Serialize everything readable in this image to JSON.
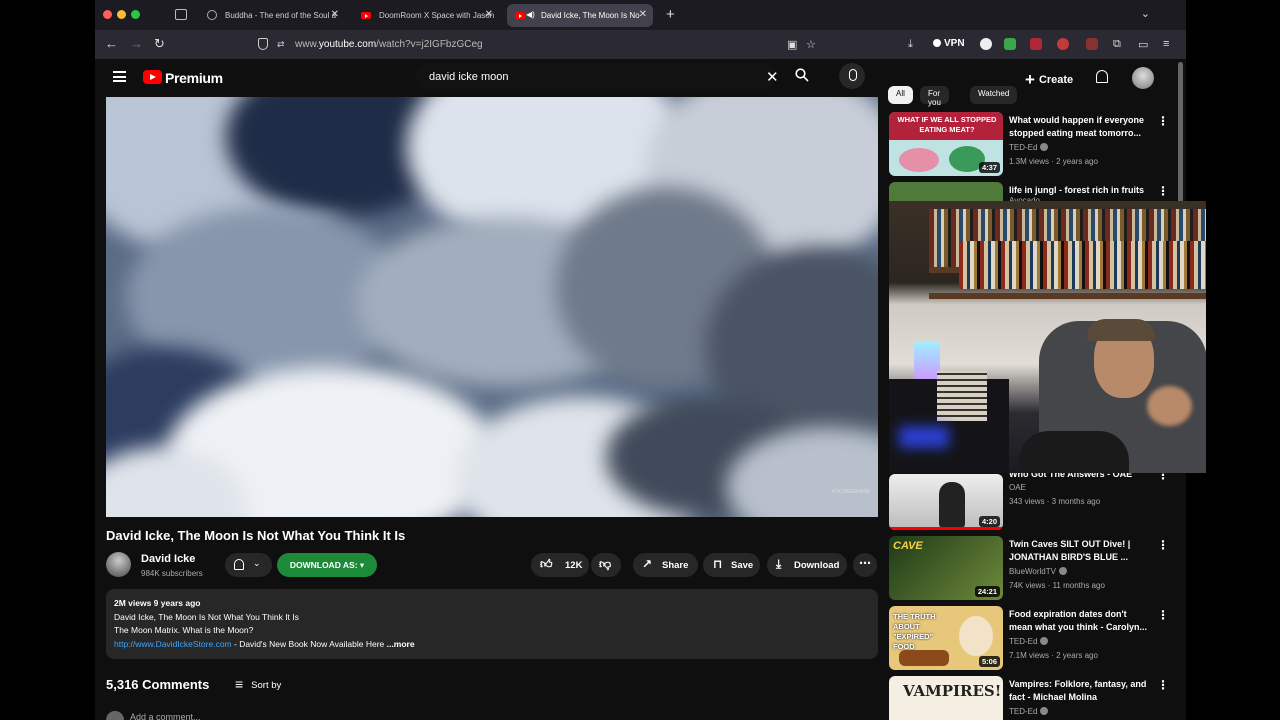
{
  "browser": {
    "tabs": [
      {
        "title": "Buddha - The end of the Soul a",
        "active": false
      },
      {
        "title": "DoomRoom X Space with Jason",
        "active": false
      },
      {
        "title": "David Icke, The Moon Is No",
        "active": true
      }
    ],
    "url_prefix": "www.",
    "url_host": "youtube.com",
    "url_path": "/watch?v=j2IGFbzGCeg",
    "vpn_label": "VPN"
  },
  "masthead": {
    "logo_text": "Premium",
    "search_value": "david icke moon",
    "create_label": "Create"
  },
  "video": {
    "title": "David Icke, The Moon Is Not What You Think It Is",
    "channel": "David Icke",
    "subscribers": "984K subscribers",
    "download_as_label": "DOWNLOAD AS: ▾",
    "likes": "12K",
    "share_label": "Share",
    "save_label": "Save",
    "download_label": "Download",
    "watermark": "FOOTAGEFARM"
  },
  "description": {
    "meta": "2M views  9 years ago",
    "line1": "David Icke, The Moon Is Not What You Think It Is",
    "line2": "The Moon Matrix. What is the Moon?",
    "link": "http://www.DavidIckeStore.com",
    "line3_rest": " - David's New Book Now Available Here",
    "more": "...more"
  },
  "comments": {
    "count_label": "5,316 Comments",
    "sort_label": "Sort by",
    "add_placeholder": "Add a comment..."
  },
  "sidebar": {
    "chips": [
      "All",
      "For you",
      "Watched"
    ],
    "recommendations": [
      {
        "title": "What would happen if everyone stopped eating meat tomorro...",
        "channel": "TED-Ed",
        "verified": true,
        "stats": "1.3M views · 2 years ago",
        "duration": "4:37",
        "thumb_text": "WHAT IF WE ALL STOPPED EATING MEAT?"
      },
      {
        "title": "life in jungl - forest rich in fruits",
        "channel": "Avocado",
        "verified": false,
        "stats": "",
        "duration": "",
        "thumb_text": ""
      },
      {
        "title": "Who Got The Answers - OAE",
        "channel": "OAE",
        "verified": false,
        "stats": "343 views · 3 months ago",
        "duration": "4:20",
        "thumb_text": ""
      },
      {
        "title": "Twin Caves SILT OUT Dive! | JONATHAN BIRD'S BLUE ...",
        "channel": "BlueWorldTV",
        "verified": true,
        "stats": "74K views · 11 months ago",
        "duration": "24:21",
        "thumb_text": "CAVE"
      },
      {
        "title": "Food expiration dates don't mean what you think - Carolyn...",
        "channel": "TED-Ed",
        "verified": true,
        "stats": "7.1M views · 2 years ago",
        "duration": "5:06",
        "thumb_text": "THE TRUTH ABOUT \"EXPIRED\" FOOD"
      },
      {
        "title": "Vampires: Folklore, fantasy, and fact - Michael Molina",
        "channel": "TED-Ed",
        "verified": true,
        "stats": "",
        "duration": "",
        "thumb_text": "VAMPIRES!"
      }
    ]
  },
  "colors": {
    "background": "#0f0f0f",
    "accent_red": "#ff0000",
    "download_green": "#1d8a3a",
    "link_blue": "#3ea6ff"
  }
}
